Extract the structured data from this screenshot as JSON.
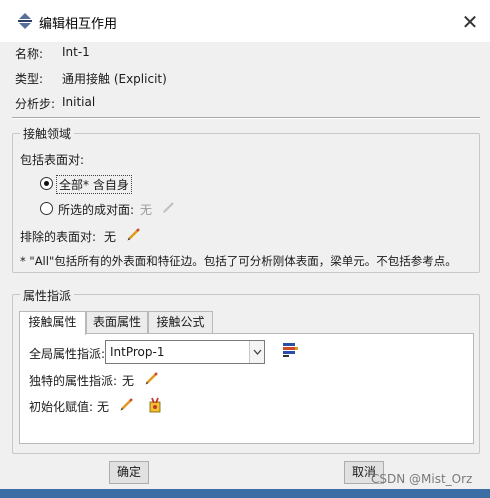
{
  "window": {
    "title": "编辑相互作用",
    "close_glyph": "✕"
  },
  "info": {
    "name_label": "名称:",
    "name_value": "Int-1",
    "type_label": "类型:",
    "type_value": "通用接触 (Explicit)",
    "step_label": "分析步:",
    "step_value": "Initial"
  },
  "contact_domain": {
    "title": "接触领域",
    "include_label": "包括表面对:",
    "option_all": "全部* 含自身",
    "option_selected": "所选的成对面:",
    "option_selected_value": "无",
    "exclude_label": "排除的表面对:",
    "exclude_value": "无",
    "note": "* \"All\"包括所有的外表面和特征边。包括了可分析刚体表面，梁单元。不包括参考点。"
  },
  "property_assignment": {
    "title": "属性指派",
    "tabs": [
      "接触属性",
      "表面属性",
      "接触公式"
    ],
    "global_label": "全局属性指派:",
    "global_value": "IntProp-1",
    "unique_label": "独特的属性指派:",
    "unique_value": "无",
    "init_label": "初始化赋值:",
    "init_value": "无"
  },
  "buttons": {
    "ok": "确定",
    "cancel": "取消"
  },
  "watermark": "CSDN @Mist_Orz",
  "icons": [
    "abaqus-interaction-icon",
    "close-icon",
    "pencil-icon",
    "property-manager-icon",
    "initialization-icon",
    "chevron-down-icon"
  ]
}
